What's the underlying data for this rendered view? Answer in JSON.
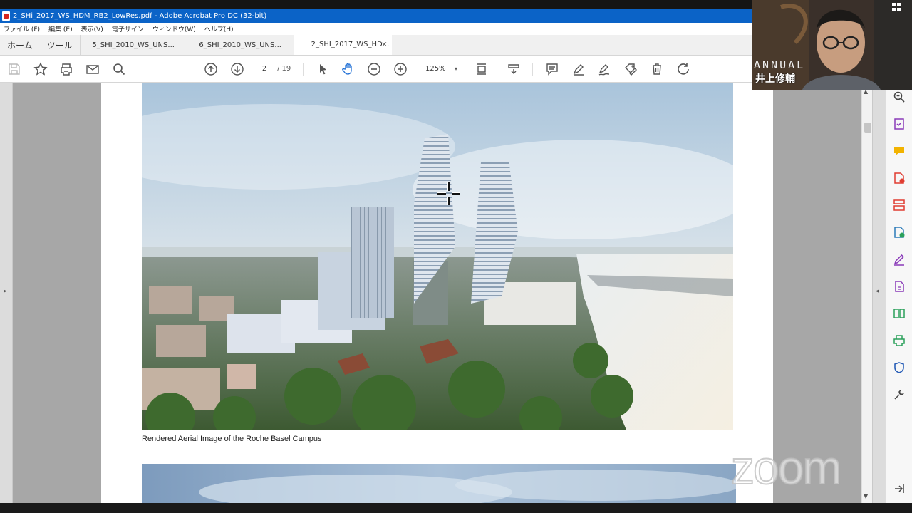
{
  "window": {
    "title": "2_SHi_2017_WS_HDM_RB2_LowRes.pdf - Adobe Acrobat Pro DC (32-bit)"
  },
  "menu": [
    "ファイル (F)",
    "編集 (E)",
    "表示(V)",
    "電子サイン",
    "ウィンドウ(W)",
    "ヘルプ(H)"
  ],
  "tabs": {
    "home": "ホーム",
    "tools": "ツール",
    "documents": [
      {
        "label": "5_SHI_2010_WS_UNS...",
        "active": false
      },
      {
        "label": "6_SHI_2010_WS_UNS...",
        "active": false
      },
      {
        "label": "2_SHI_2017_WS_HD...",
        "active": true
      }
    ],
    "close_glyph": "×"
  },
  "toolbar": {
    "page_current": "2",
    "page_total": "/ 19",
    "zoom": "125%"
  },
  "document": {
    "caption": "Rendered Aerial Image of the Roche Basel Campus"
  },
  "webcam": {
    "participant_name": "井上修輔",
    "banner_text": "ANNUAL"
  },
  "watermark": "zoom",
  "colors": {
    "title_bar": "#0b63c7",
    "accent_blue": "#1f6fd6"
  }
}
